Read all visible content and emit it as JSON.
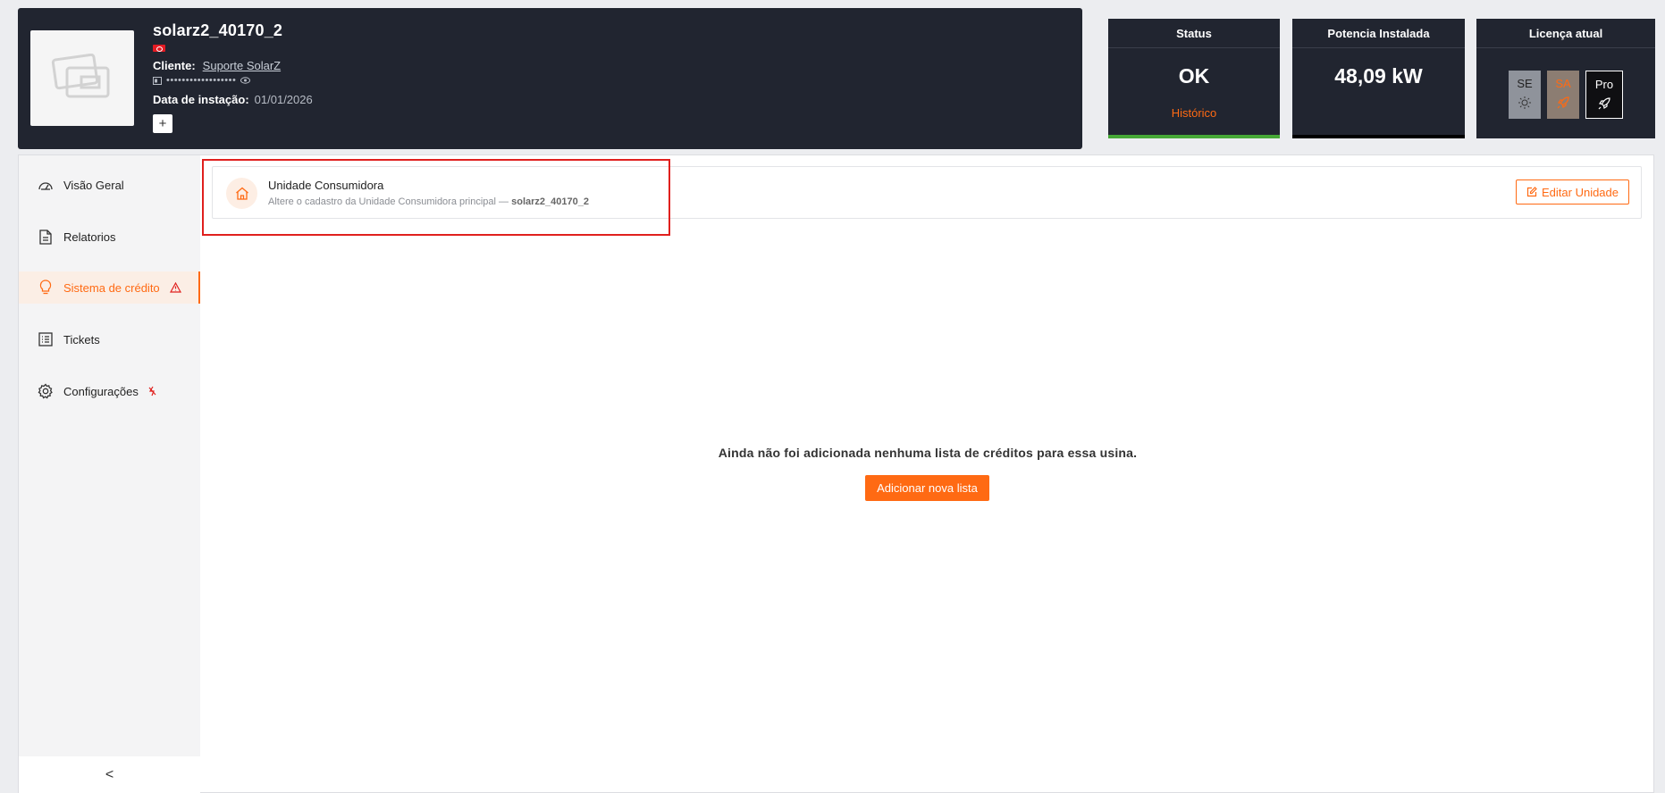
{
  "plant": {
    "name": "solarz2_40170_2",
    "client_label": "Cliente:",
    "client_name": "Suporte SolarZ",
    "password_mask": "••••••••••••••••••",
    "install_label": "Data de instação:",
    "install_date": "01/01/2026",
    "add_label": "+",
    "flag_color": "#e31b23"
  },
  "stats": {
    "status": {
      "title": "Status",
      "value": "OK",
      "link": "Histórico",
      "bar_color": "#46a836"
    },
    "power": {
      "title": "Potencia Instalada",
      "value": "48,09 kW",
      "bar_color": "#000000"
    },
    "license": {
      "title": "Licença atual",
      "tiers": [
        {
          "label": "SE",
          "icon": "sun-icon"
        },
        {
          "label": "SA",
          "icon": "rocket-icon"
        },
        {
          "label": "Pro",
          "icon": "rocket-icon",
          "selected": true
        }
      ]
    }
  },
  "sidebar": {
    "items": [
      {
        "label": "Visão Geral",
        "icon": "speedometer-icon"
      },
      {
        "label": "Relatorios",
        "icon": "document-icon"
      },
      {
        "label": "Sistema de crédito",
        "icon": "lightbulb-icon",
        "active": true,
        "badge": "warning-icon"
      },
      {
        "label": "Tickets",
        "icon": "list-icon"
      },
      {
        "label": "Configurações",
        "icon": "gear-icon",
        "badge": "lightning-off-icon"
      }
    ],
    "collapse_label": "<"
  },
  "unit": {
    "title": "Unidade Consumidora",
    "subtitle": "Altere o cadastro da Unidade Consumidora principal —",
    "subtitle_name": "solarz2_40170_2",
    "edit_label": "Editar Unidade"
  },
  "empty": {
    "message": "Ainda não foi adicionada nenhuma lista de créditos para essa usina.",
    "button_label": "Adicionar nova lista"
  },
  "colors": {
    "accent": "#ff6a13",
    "dark": "#212530",
    "highlight": "#e0201e"
  }
}
